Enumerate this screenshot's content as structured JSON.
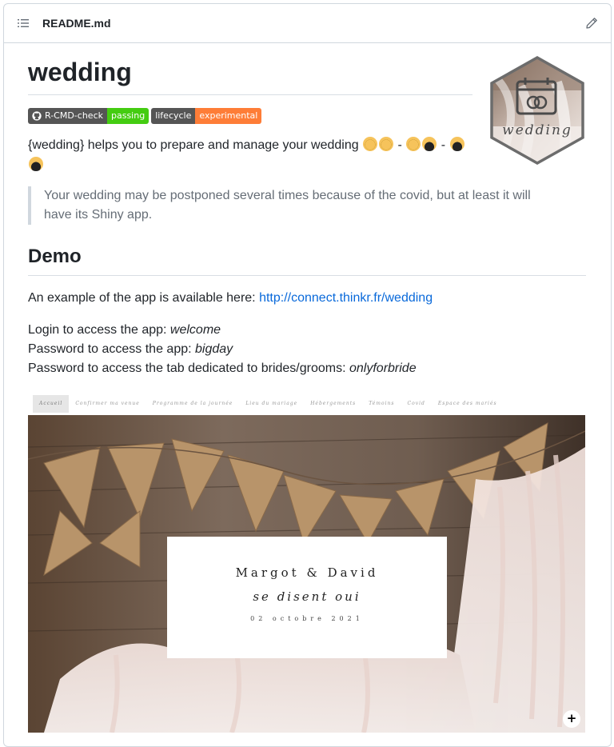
{
  "file": {
    "name": "README.md"
  },
  "readme": {
    "title": "wedding",
    "logo_text": "wedding",
    "badges": [
      {
        "label": "R-CMD-check",
        "status": "passing"
      },
      {
        "label": "lifecycle",
        "status": "experimental"
      }
    ],
    "intro_text": "{wedding} helps you to prepare and manage your wedding",
    "intro_sep": " - ",
    "quote": "Your wedding may be postponed several times because of the covid, but at least it will have its Shiny app.",
    "demo_heading": "Demo",
    "example_text": "An example of the app is available here: ",
    "example_link": "http://connect.thinkr.fr/wedding",
    "login_label": "Login to access the app: ",
    "login_value": "welcome",
    "password_label": "Password to access the app: ",
    "password_value": "bigday",
    "bride_label": "Password to access the tab dedicated to brides/grooms: ",
    "bride_value": "onlyforbride"
  },
  "app_screenshot": {
    "nav": [
      "Accueil",
      "Confirmer ma venue",
      "Programme de la journée",
      "Lieu du mariage",
      "Hébergements",
      "Témoins",
      "Covid",
      "Espace des mariés"
    ],
    "active_nav": "Accueil",
    "names": "Margot & David",
    "tagline": "se disent oui",
    "date": "02 octobre 2021",
    "fab": "+"
  },
  "colors": {
    "link": "#0969da",
    "badge_green": "#44cc11",
    "badge_orange": "#fe7d37",
    "badge_gray": "#555555"
  }
}
